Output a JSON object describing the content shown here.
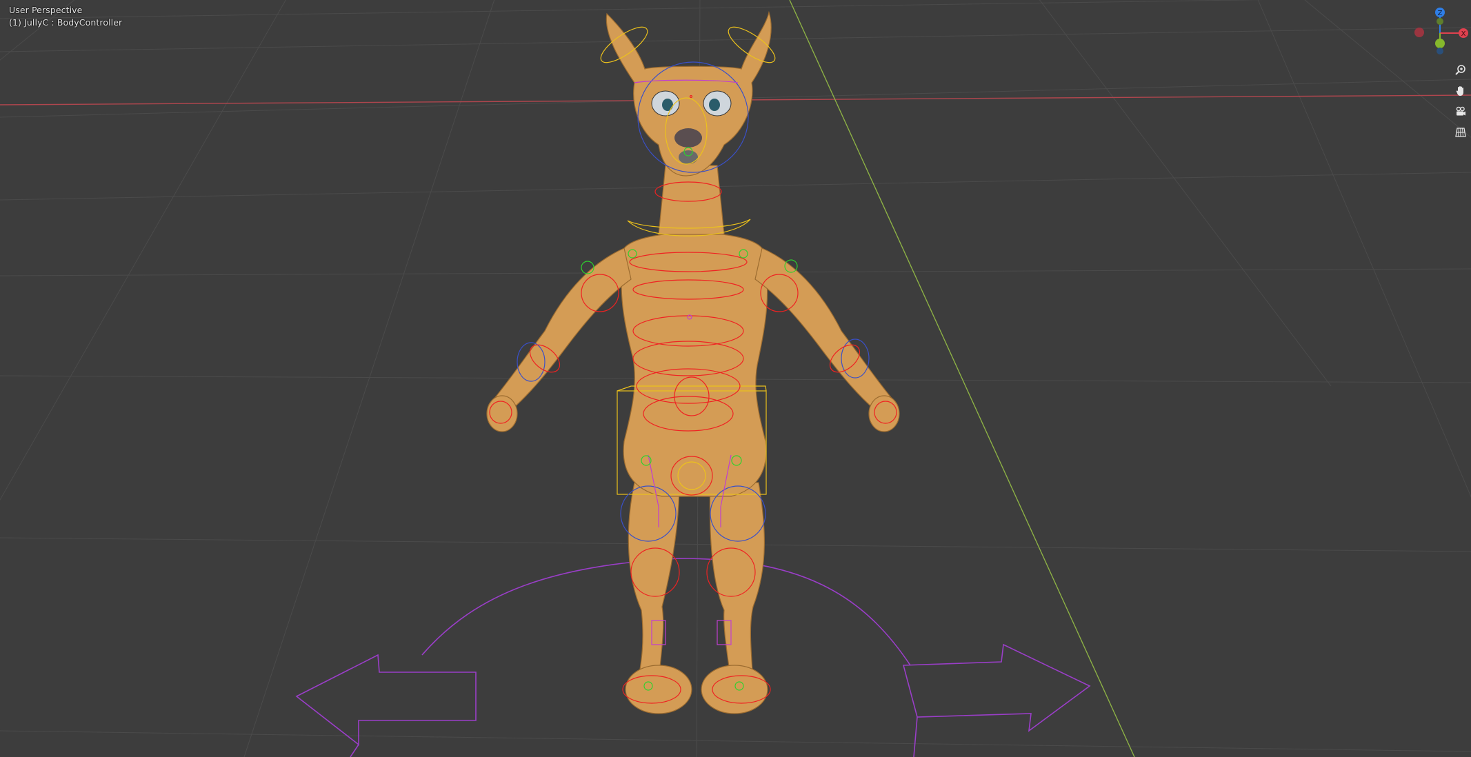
{
  "viewport": {
    "view_name": "User Perspective",
    "active_object": "(1) JullyC : BodyController",
    "background_color": "#3d3d3d",
    "grid_color": "#4b4b4b",
    "x_axis_color": "#b0464e",
    "y_axis_color": "#8cb045"
  },
  "navigation_gizmo": {
    "z_label": "Z",
    "x_label": "X",
    "z_color": "#2f7ee6",
    "x_color": "#e0414f",
    "y_color": "#86b82c"
  },
  "navigation_tools": [
    {
      "icon": "zoom-icon",
      "label": "Zoom"
    },
    {
      "icon": "pan-hand-icon",
      "label": "Move"
    },
    {
      "icon": "camera-icon",
      "label": "Toggle camera view"
    },
    {
      "icon": "orthographic-grid-icon",
      "label": "Toggle perspective/orthographic"
    }
  ],
  "model": {
    "body_color": "#d49c55",
    "rig_colors": {
      "controller_red": "#ef2222",
      "controller_blue": "#3a50c8",
      "controller_yellow": "#ecc21c",
      "controller_green": "#2ed22e",
      "controller_magenta": "#c03ed0",
      "root_purple": "#9a3ec8"
    }
  }
}
